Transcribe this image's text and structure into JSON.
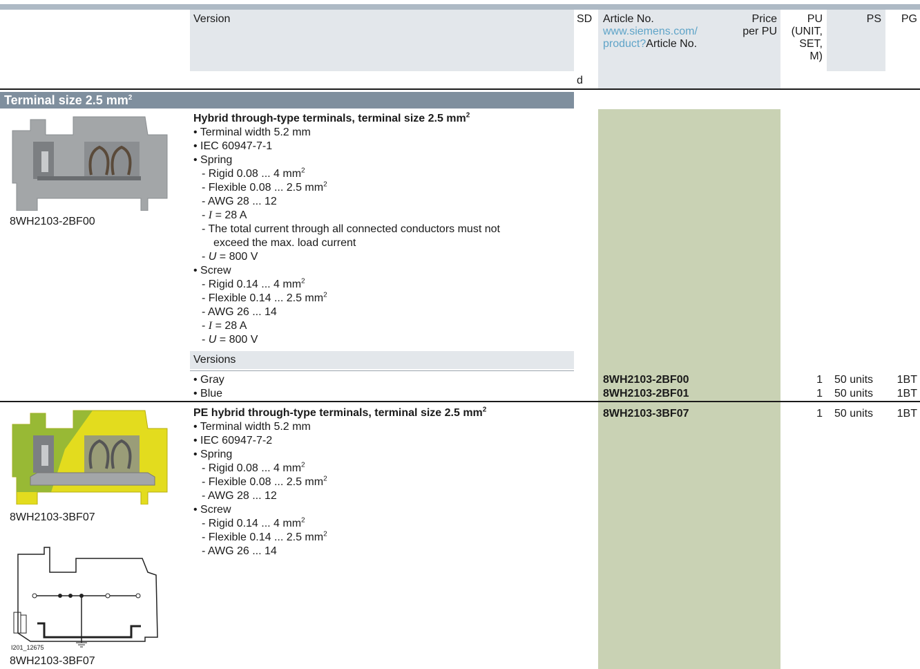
{
  "header": {
    "version": "Version",
    "sd": "SD",
    "article_no": "Article No.",
    "link_line1": "www.siemens.com/",
    "link_line2": "product?",
    "article_no_suffix": "Article No.",
    "price_line1": "Price",
    "price_line2": "per PU",
    "pu_lines": [
      "PU",
      "(UNIT,",
      "SET,",
      "M)"
    ],
    "ps": "PS",
    "pg": "PG",
    "sd_unit": "d"
  },
  "section": {
    "title": "Terminal size 2.5 mm",
    "title_sup": "2"
  },
  "product1": {
    "caption": "8WH2103-2BF00",
    "title": "Hybrid through-type terminals, terminal size 2.5 mm",
    "title_sup": "2",
    "lines": [
      "• Terminal width 5.2 mm",
      "• IEC 60947-7-1",
      "• Spring",
      "- Rigid 0.08 ... 4 mm",
      "- Flexible 0.08 ... 2.5 mm",
      "- AWG 28 ... 12",
      "= 28 A",
      "- The total current through all connected conductors must not",
      "exceed the max. load current",
      "= 800 V",
      "• Screw",
      "- Rigid 0.14 ... 4 mm",
      "- Flexible 0.14 ... 2.5 mm",
      "- AWG 26 ... 14",
      "= 28 A",
      "= 800 V"
    ],
    "var_I": "I",
    "var_U": "U",
    "sup2": "2",
    "versions_label": "Versions",
    "rows": [
      {
        "label": "• Gray",
        "article": "8WH2103-2BF00",
        "pu": "1",
        "ps": "50 units",
        "pg": "1BT"
      },
      {
        "label": "• Blue",
        "article": "8WH2103-2BF01",
        "pu": "1",
        "ps": "50 units",
        "pg": "1BT"
      }
    ]
  },
  "product2": {
    "caption": "8WH2103-3BF07",
    "caption2": "8WH2103-3BF07",
    "drawing_code": "I201_12675",
    "title": "PE hybrid through-type terminals, terminal size 2.5 mm",
    "title_sup": "2",
    "article": "8WH2103-3BF07",
    "pu": "1",
    "ps": "50 units",
    "pg": "1BT",
    "lines": [
      "• Terminal width 5.2 mm",
      "• IEC 60947-7-2",
      "• Spring",
      "- Rigid 0.08 ... 4 mm",
      "- Flexible 0.08 ... 2.5 mm",
      "- AWG 28 ... 12",
      "• Screw",
      "- Rigid 0.14 ... 4 mm",
      "- Flexible 0.14 ... 2.5 mm",
      "- AWG 26 ... 14"
    ]
  },
  "colors": {
    "header_shade": "#e3e7eb",
    "section_bar": "#7f8f9e",
    "article_column": "#c9d2b4",
    "link": "#5fa4c8",
    "pe_green": "#8bb33a",
    "pe_yellow": "#e3dc1e",
    "terminal_gray": "#a3a6a8"
  }
}
